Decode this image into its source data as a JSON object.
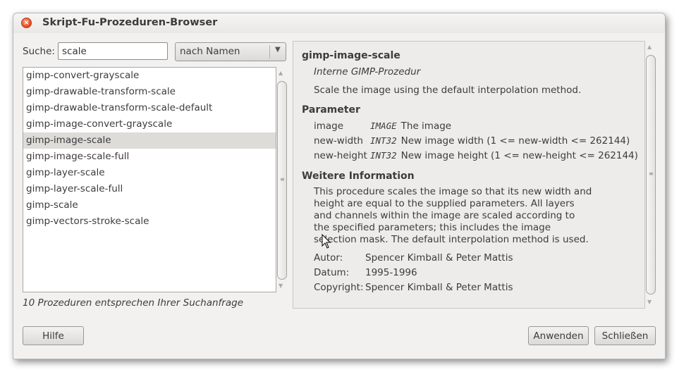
{
  "window": {
    "title": "Skript-Fu-Prozeduren-Browser",
    "close_glyph": "×"
  },
  "search": {
    "label": "Suche:",
    "value": "scale",
    "mode": "nach Namen"
  },
  "procedures": [
    "gimp-convert-grayscale",
    "gimp-drawable-transform-scale",
    "gimp-drawable-transform-scale-default",
    "gimp-image-convert-grayscale",
    "gimp-image-scale",
    "gimp-image-scale-full",
    "gimp-layer-scale",
    "gimp-layer-scale-full",
    "gimp-scale",
    "gimp-vectors-stroke-scale"
  ],
  "selected_index": 4,
  "status": "10 Prozeduren entsprechen Ihrer Suchanfrage",
  "info": {
    "name": "gimp-image-scale",
    "kind": "Interne GIMP-Prozedur",
    "blurb": "Scale the image using the default interpolation method.",
    "params_heading": "Parameter",
    "params": [
      {
        "name": "image",
        "type": "IMAGE",
        "desc": "The image"
      },
      {
        "name": "new-width",
        "type": "INT32",
        "desc": "New image width (1 <= new-width <= 262144)"
      },
      {
        "name": "new-height",
        "type": "INT32",
        "desc": "New image height (1 <= new-height <= 262144)"
      }
    ],
    "more_heading": "Weitere Information",
    "help_lines": [
      "This procedure scales the image so that its new width and",
      "height are equal to the supplied parameters. All layers",
      "and channels within the image are scaled according to",
      "the specified parameters; this includes the image",
      "selection mask. The default interpolation method is used."
    ],
    "author_label": "Autor:",
    "author": "Spencer Kimball & Peter Mattis",
    "date_label": "Datum:",
    "date": "1995-1996",
    "copyright_label": "Copyright:",
    "copyright": "Spencer Kimball & Peter Mattis"
  },
  "buttons": {
    "help": "Hilfe",
    "apply": "Anwenden",
    "close": "Schließen"
  },
  "icons": {
    "combo_arrow": "▼",
    "scroll_up": "▲",
    "scroll_down": "▼",
    "grip": "≡"
  }
}
